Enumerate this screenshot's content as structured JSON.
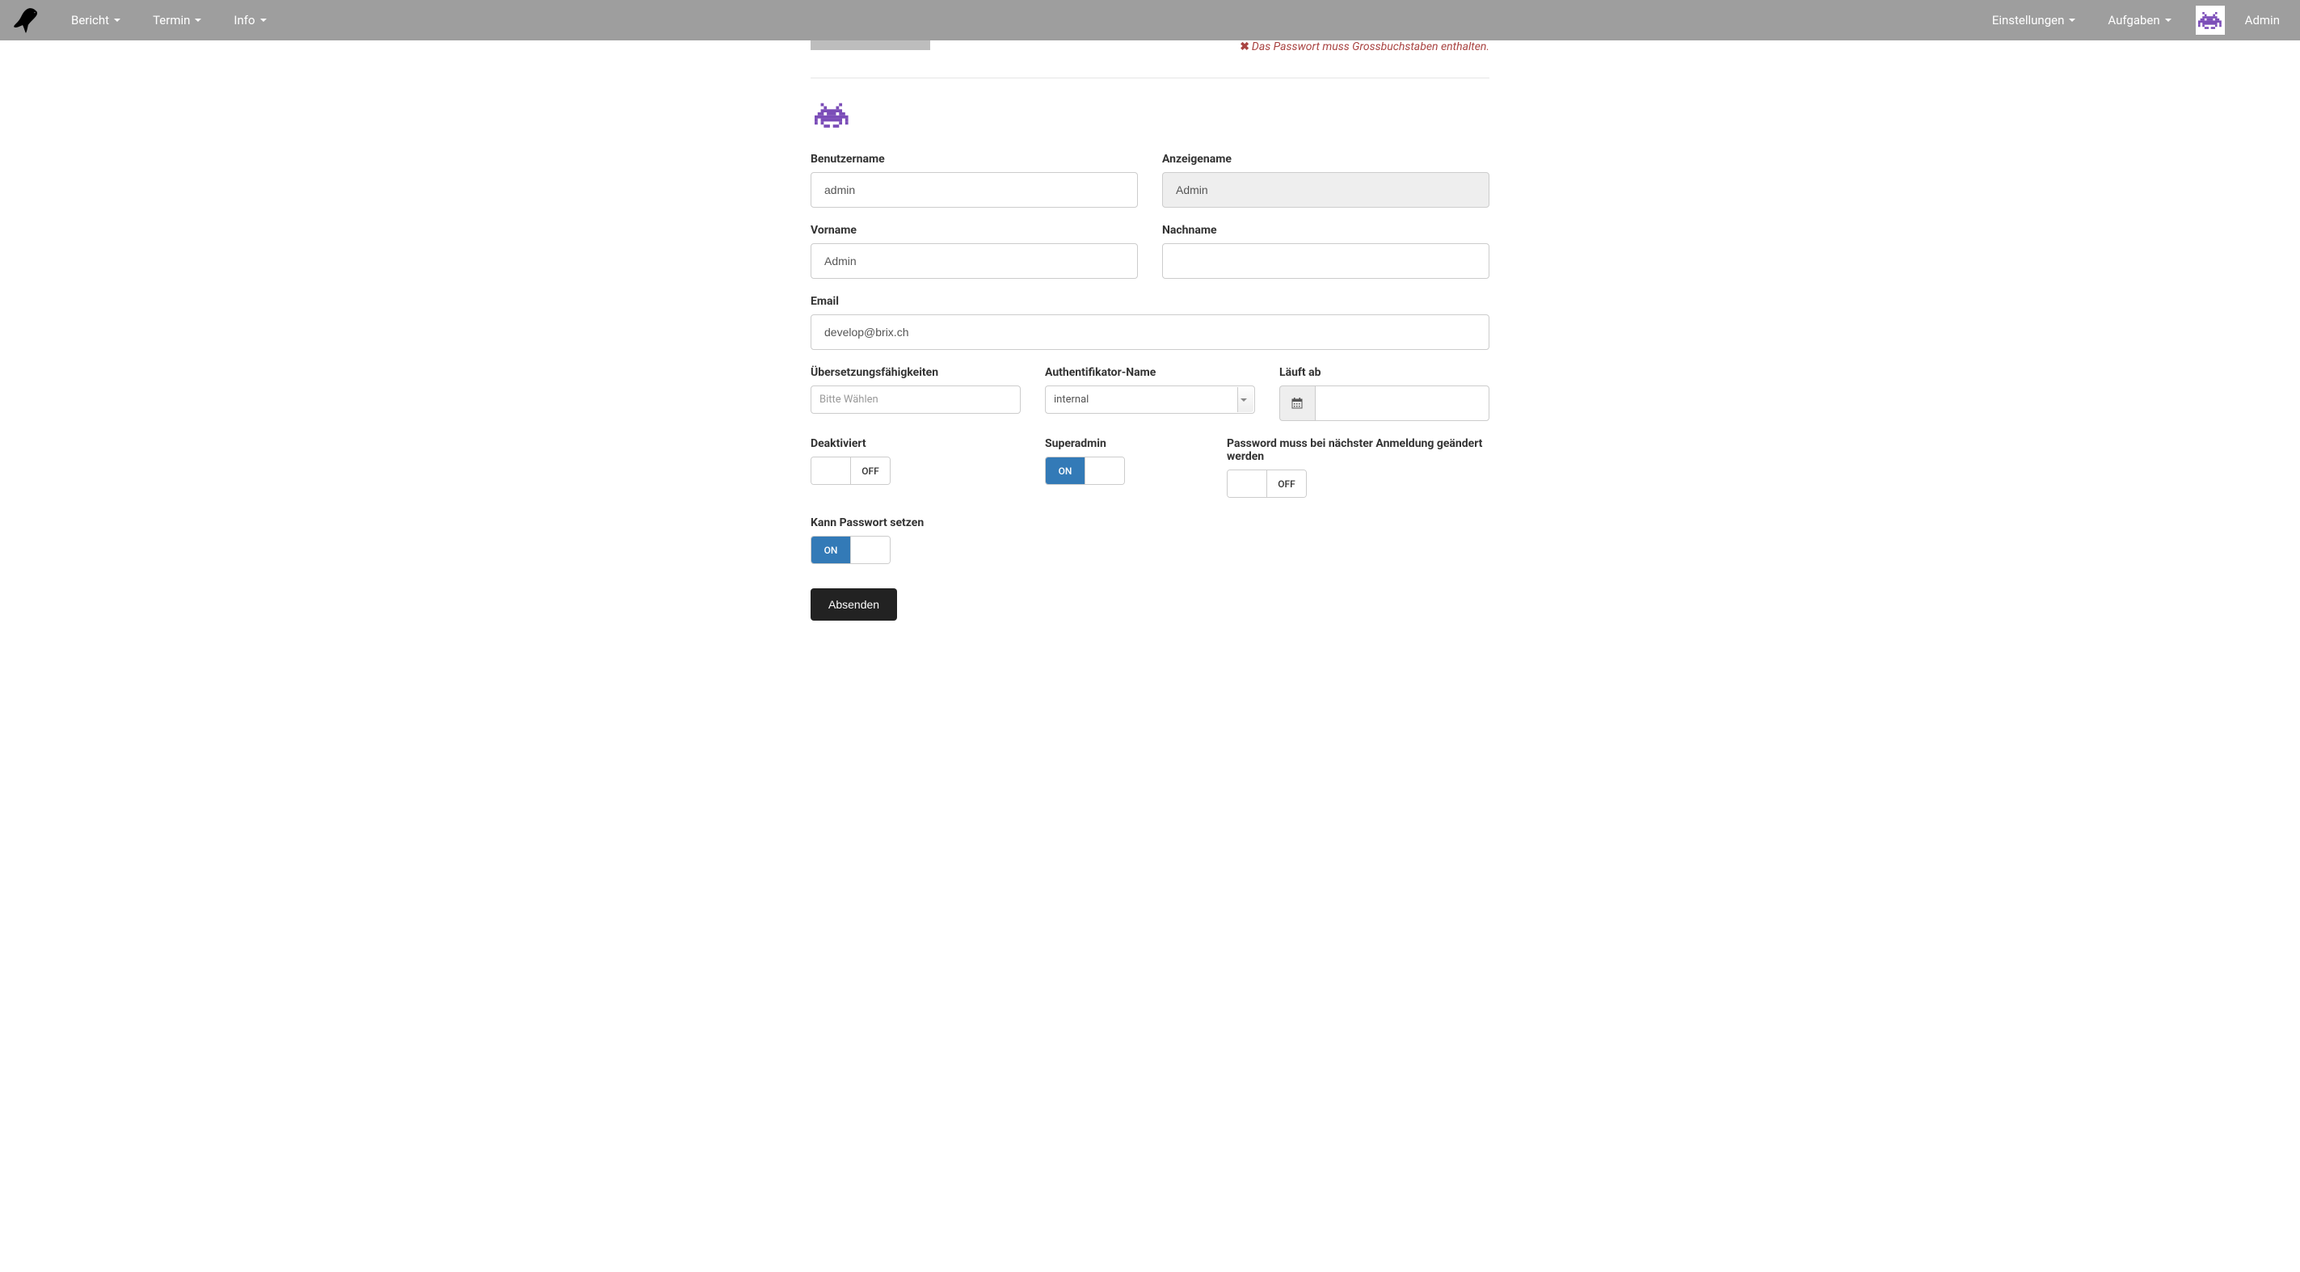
{
  "nav": {
    "left": {
      "bericht": "Bericht",
      "termin": "Termin",
      "info": "Info"
    },
    "right": {
      "einstellungen": "Einstellungen",
      "aufgaben": "Aufgaben",
      "username": "Admin"
    }
  },
  "error": {
    "password_uppercase": "Das Passwort muss Grossbuchstaben enthalten."
  },
  "form": {
    "labels": {
      "benutzername": "Benutzername",
      "anzeigename": "Anzeigename",
      "vorname": "Vorname",
      "nachname": "Nachname",
      "email": "Email",
      "uebersetzung": "Übersetzungsfähigkeiten",
      "authentifikator": "Authentifikator-Name",
      "laeuftab": "Läuft ab",
      "deaktiviert": "Deaktiviert",
      "superadmin": "Superadmin",
      "password_change": "Password muss bei nächster Anmeldung geändert werden",
      "kann_passwort": "Kann Passwort setzen"
    },
    "values": {
      "benutzername": "admin",
      "anzeigename": "Admin",
      "vorname": "Admin",
      "nachname": "",
      "email": "develop@brix.ch",
      "uebersetzung_placeholder": "Bitte Wählen",
      "authentifikator": "internal",
      "laeuftab": ""
    },
    "toggles": {
      "on": "ON",
      "off": "OFF"
    },
    "submit": "Absenden"
  }
}
